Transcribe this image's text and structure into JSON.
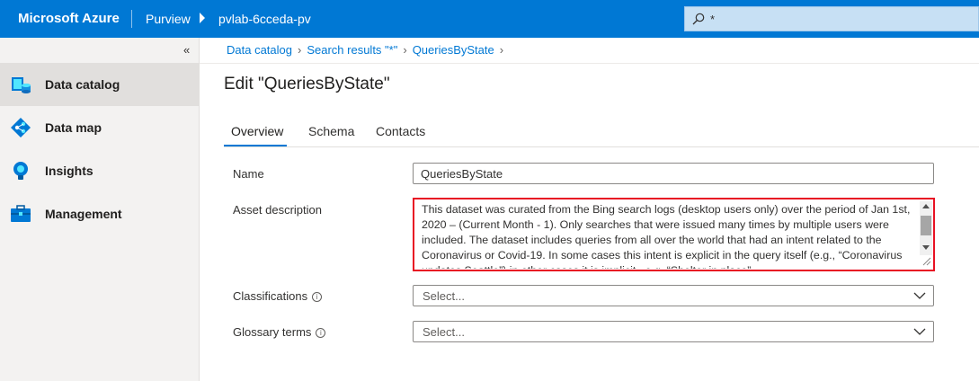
{
  "header": {
    "brand": "Microsoft Azure",
    "product": "Purview",
    "account": "pvlab-6cceda-pv",
    "search_value": "*"
  },
  "sidebar": {
    "collapse_label": "«",
    "items": [
      {
        "label": "Data catalog",
        "icon": "data-catalog-icon",
        "active": true
      },
      {
        "label": "Data map",
        "icon": "data-map-icon"
      },
      {
        "label": "Insights",
        "icon": "insights-icon"
      },
      {
        "label": "Management",
        "icon": "management-icon"
      }
    ]
  },
  "breadcrumb": [
    "Data catalog",
    "Search results \"*\"",
    "QueriesByState"
  ],
  "page": {
    "title": "Edit \"QueriesByState\""
  },
  "tabs": [
    "Overview",
    "Schema",
    "Contacts"
  ],
  "form": {
    "name_label": "Name",
    "name_value": "QueriesByState",
    "description_label": "Asset description",
    "description_value": "This dataset was curated from the Bing search logs (desktop users only) over the period of Jan 1st, 2020 – (Current Month - 1). Only searches that were issued many times by multiple users were included. The dataset includes queries from all over the world that had an intent related to the Coronavirus or Covid-19. In some cases this intent is explicit in the query itself (e.g., “Coronavirus updates Seattle”) in other cases it is implicit , e.g. “Shelter in place”",
    "classifications_label": "Classifications",
    "classifications_placeholder": "Select...",
    "glossary_label": "Glossary terms",
    "glossary_placeholder": "Select...",
    "info_glyph": "i"
  },
  "colors": {
    "azure_blue": "#0078d4",
    "highlight_red": "#e81123"
  }
}
